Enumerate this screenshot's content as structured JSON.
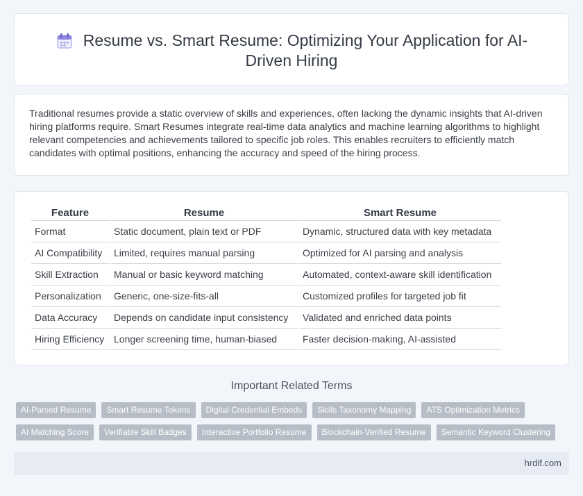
{
  "header": {
    "title": "Resume vs. Smart Resume: Optimizing Your Application for AI-Driven Hiring",
    "icon": "calendar-icon"
  },
  "intro": {
    "text": "Traditional resumes provide a static overview of skills and experiences, often lacking the dynamic insights that AI-driven hiring platforms require. Smart Resumes integrate real-time data analytics and machine learning algorithms to highlight relevant competencies and achievements tailored to specific job roles. This enables recruiters to efficiently match candidates with optimal positions, enhancing the accuracy and speed of the hiring process."
  },
  "table": {
    "headers": [
      "Feature",
      "Resume",
      "Smart Resume"
    ],
    "rows": [
      [
        "Format",
        "Static document, plain text or PDF",
        "Dynamic, structured data with key metadata"
      ],
      [
        "AI Compatibility",
        "Limited, requires manual parsing",
        "Optimized for AI parsing and analysis"
      ],
      [
        "Skill Extraction",
        "Manual or basic keyword matching",
        "Automated, context-aware skill identification"
      ],
      [
        "Personalization",
        "Generic, one-size-fits-all",
        "Customized profiles for targeted job fit"
      ],
      [
        "Data Accuracy",
        "Depends on candidate input consistency",
        "Validated and enriched data points"
      ],
      [
        "Hiring Efficiency",
        "Longer screening time, human-biased",
        "Faster decision-making, AI-assisted"
      ]
    ]
  },
  "related": {
    "title": "Important Related Terms",
    "rows": [
      [
        "AI-Parsed Resume",
        "Smart Resume Tokens",
        "Digital Credential Embeds",
        "Skills Taxonomy Mapping",
        "ATS Optimization Metrics"
      ],
      [
        "AI Matching Score",
        "Verifiable Skill Badges",
        "Interactive Portfolio Resume",
        "Blockchain-Verified Resume",
        "Semantic Keyword Clustering"
      ]
    ]
  },
  "footer": {
    "site": "hrdif.com"
  },
  "colors": {
    "page_bg": "#f2f5f9",
    "tag_bg": "#b7bdc7",
    "footer_bg": "#e6ebf4",
    "icon_accent": "#7b6fd6"
  }
}
